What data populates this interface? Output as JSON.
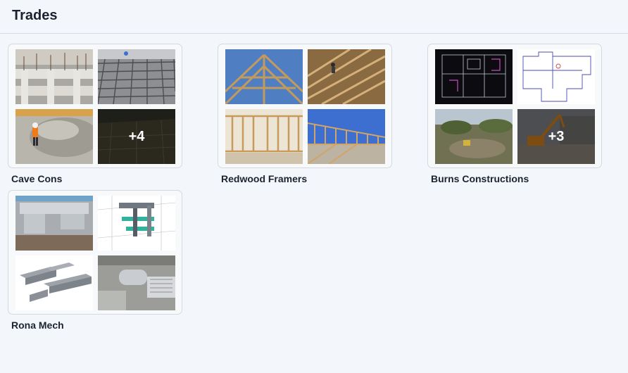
{
  "page": {
    "title": "Trades"
  },
  "trades": [
    {
      "name": "Cave Cons",
      "images": [
        "concrete-formwork-photo",
        "rebar-mesh-photo",
        "concrete-pouring-worker-photo",
        "foundation-excavation-photo"
      ],
      "more_count": "+4"
    },
    {
      "name": "Redwood Framers",
      "images": [
        "roof-trusses-photo",
        "roof-truss-worker-photo",
        "timber-wall-framing-photo",
        "framing-site-photo"
      ],
      "more_count": ""
    },
    {
      "name": "Burns Constructions",
      "images": [
        "dark-floor-plan-drawing",
        "white-floor-plan-drawing",
        "land-clearing-photo",
        "excavator-demolition-photo"
      ],
      "more_count": "+3"
    },
    {
      "name": "Rona Mech",
      "images": [
        "hvac-ductwork-room-photo",
        "ductwork-3d-model-render",
        "duct-3d-drawing",
        "ceiling-ductwork-photo"
      ],
      "more_count": ""
    }
  ]
}
